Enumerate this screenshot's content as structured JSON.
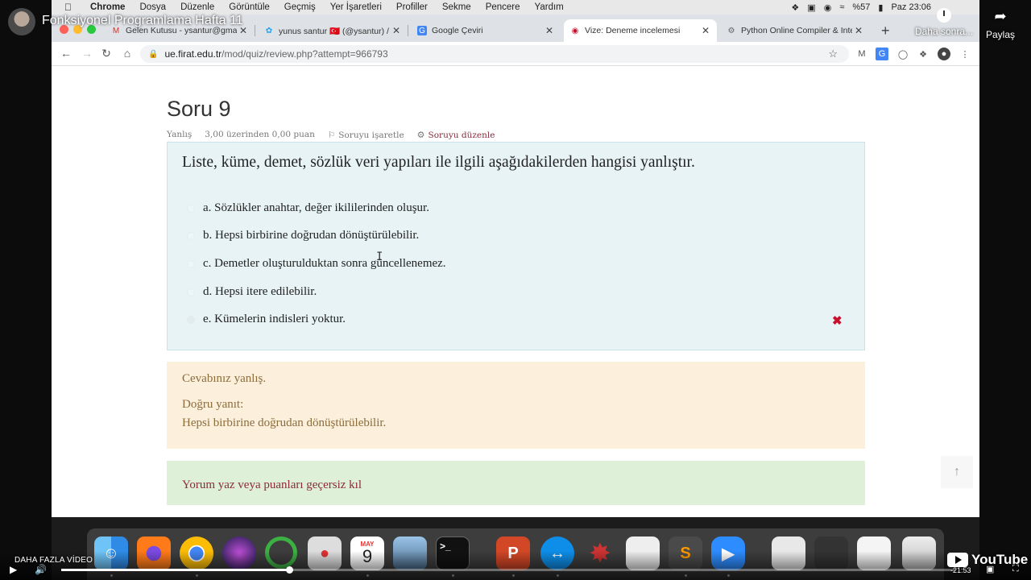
{
  "youtube": {
    "video_title": "Fonksiyonel Programlama Hafta 11",
    "watch_later_label": "Daha sonra...",
    "share_label": "Paylaş",
    "more_videos_label": "DAHA FAZLA VİDEO",
    "time_remaining": "-21:53",
    "progress_fraction": 0.255,
    "logo_text": "YouTube"
  },
  "menubar": {
    "apple_icon": "apple-icon",
    "items": [
      "Chrome",
      "Dosya",
      "Düzenle",
      "Görüntüle",
      "Geçmiş",
      "Yer İşaretleri",
      "Profiller",
      "Sekme",
      "Pencere",
      "Yardım"
    ],
    "battery": "%57",
    "clock": "Paz 23:06"
  },
  "browser": {
    "tabs": [
      {
        "label": "Gelen Kutusu - ysantur@gmail",
        "icon": "gmail-icon",
        "active": false
      },
      {
        "label": "yunus santur 🇹🇷 (@ysantur) / T",
        "icon": "twitter-icon",
        "active": false
      },
      {
        "label": "Google Çeviri",
        "icon": "translate-icon",
        "active": false
      },
      {
        "label": "Vize: Deneme incelemesi",
        "icon": "moodle-icon",
        "active": true
      },
      {
        "label": "Python Online Compiler & Inte",
        "icon": "gear-icon",
        "active": false
      }
    ],
    "url_host": "ue.firat.edu.tr",
    "url_path": "/mod/quiz/review.php?attempt=966793"
  },
  "question": {
    "title": "Soru 9",
    "status": "Yanlış",
    "grade": "3,00 üzerinden 0,00 puan",
    "flag_label": "Soruyu işaretle",
    "edit_label": "Soruyu düzenle",
    "text": "Liste, küme, demet, sözlük veri yapıları ile ilgili aşağıdakilerden hangisi yanlıştır.",
    "answers": [
      {
        "label": "a. Sözlükler anahtar, değer ikililerinden oluşur.",
        "selected": false
      },
      {
        "label": "b. Hepsi birbirine doğrudan dönüştürülebilir.",
        "selected": false
      },
      {
        "label": "c. Demetler oluşturulduktan sonra güncellenemez.",
        "selected": false
      },
      {
        "label": "d. Hepsi itere edilebilir.",
        "selected": false
      },
      {
        "label": "e. Kümelerin indisleri yoktur.",
        "selected": true,
        "marked_wrong": true
      }
    ],
    "wrong_mark": "✖"
  },
  "feedback": {
    "result": "Cevabınız yanlış.",
    "correct_heading": "Doğru yanıt:",
    "correct_answer": "Hepsi birbirine doğrudan dönüştürülebilir."
  },
  "comment": {
    "link": "Yorum yaz veya puanları geçersiz kıl"
  },
  "dock": {
    "calendar_month": "MAY",
    "calendar_day": "9"
  },
  "colors": {
    "formulation_bg": "#e7f3f5",
    "feedback_bg": "#fcefdc",
    "comment_bg": "#dff0d8",
    "link": "#8a2a3a",
    "wrong_mark": "#c8102e"
  }
}
